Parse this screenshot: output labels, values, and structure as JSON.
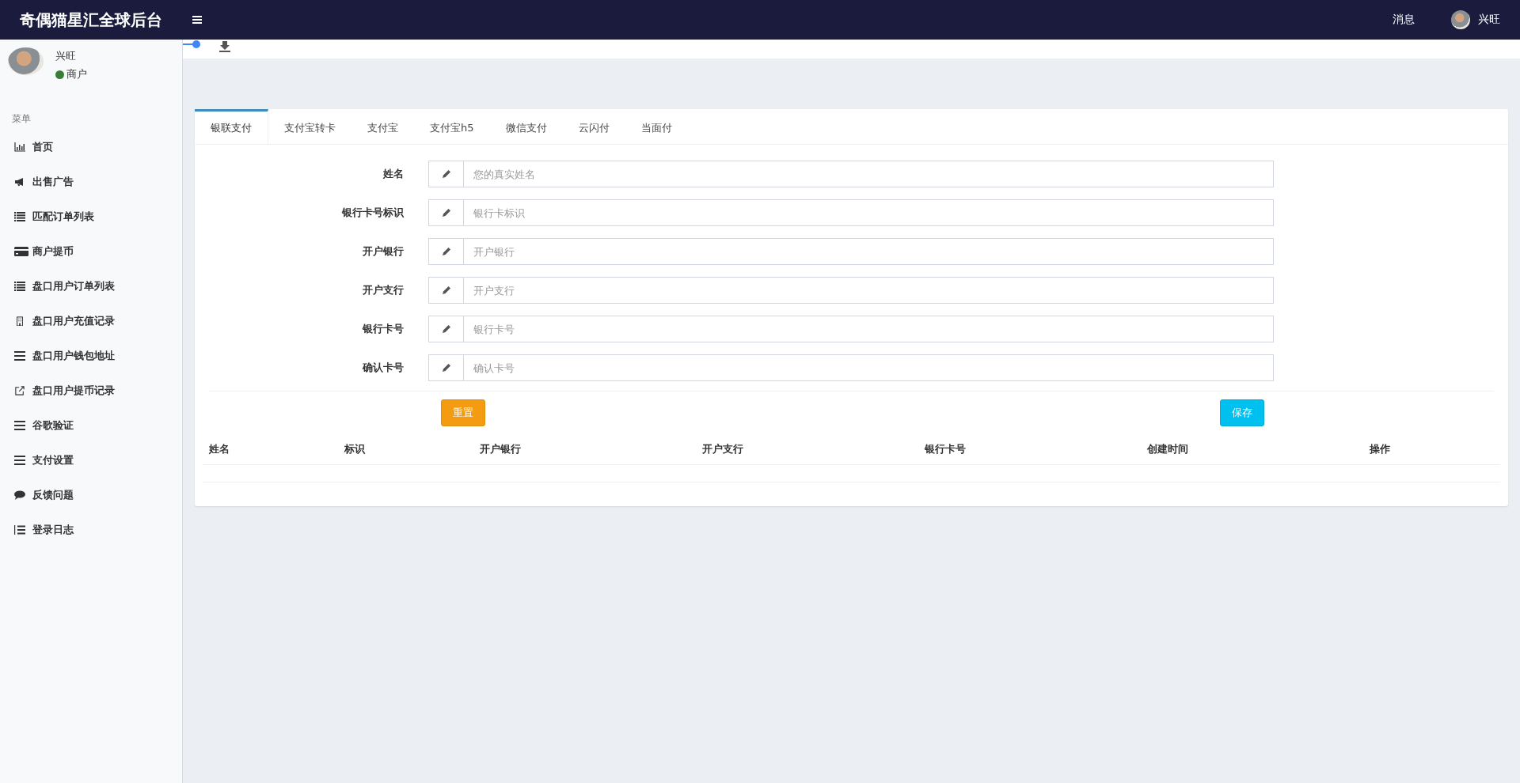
{
  "header": {
    "title": "奇偶猫星汇全球后台",
    "messages": "消息",
    "user_name": "兴旺"
  },
  "user_panel": {
    "name": "兴旺",
    "role": "商户"
  },
  "sidebar": {
    "heading": "菜单",
    "items": [
      {
        "label": "首页",
        "kind": "chart"
      },
      {
        "label": "出售广告",
        "kind": "bullhorn"
      },
      {
        "label": "匹配订单列表",
        "kind": "list"
      },
      {
        "label": "商户提币",
        "kind": "card"
      },
      {
        "label": "盘口用户订单列表",
        "kind": "list"
      },
      {
        "label": "盘口用户充值记录",
        "kind": "building"
      },
      {
        "label": "盘口用户钱包地址",
        "kind": "bars"
      },
      {
        "label": "盘口用户提币记录",
        "kind": "external"
      },
      {
        "label": "谷歌验证",
        "kind": "bars"
      },
      {
        "label": "支付设置",
        "kind": "bars"
      },
      {
        "label": "反馈问题",
        "kind": "comment"
      },
      {
        "label": "登录日志",
        "kind": "list-ol"
      }
    ]
  },
  "tabs": [
    {
      "label": "银联支付",
      "selected": true
    },
    {
      "label": "支付宝转卡",
      "selected": false
    },
    {
      "label": "支付宝",
      "selected": false
    },
    {
      "label": "支付宝h5",
      "selected": false
    },
    {
      "label": "微信支付",
      "selected": false
    },
    {
      "label": "云闪付",
      "selected": false
    },
    {
      "label": "当面付",
      "selected": false
    }
  ],
  "form": {
    "fields": [
      {
        "label": "姓名",
        "placeholder": "您的真实姓名"
      },
      {
        "label": "银行卡号标识",
        "placeholder": "银行卡标识"
      },
      {
        "label": "开户银行",
        "placeholder": "开户银行"
      },
      {
        "label": "开户支行",
        "placeholder": "开户支行"
      },
      {
        "label": "银行卡号",
        "placeholder": "银行卡号"
      },
      {
        "label": "确认卡号",
        "placeholder": "确认卡号"
      }
    ],
    "reset_button": "重置",
    "save_button": "保存"
  },
  "table": {
    "columns": [
      "姓名",
      "标识",
      "开户银行",
      "开户支行",
      "银行卡号",
      "创建时间",
      "操作"
    ]
  }
}
